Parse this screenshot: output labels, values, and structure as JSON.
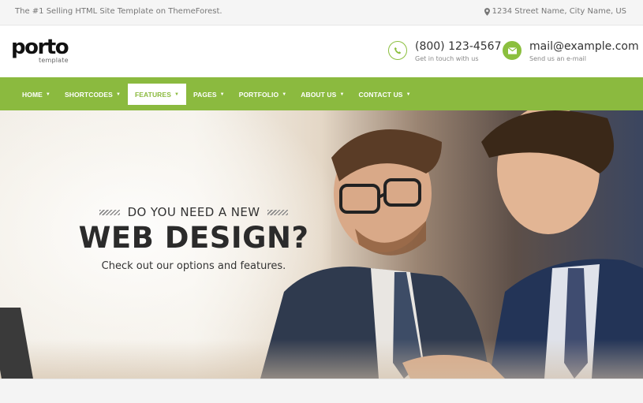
{
  "topbar": {
    "tagline": "The #1 Selling HTML Site Template on ThemeForest.",
    "address": "1234 Street Name, City Name, US",
    "address_icon": "map-marker-icon"
  },
  "header": {
    "logo_word": "porto",
    "logo_sub": "template",
    "phone": {
      "number": "(800) 123-4567",
      "caption": "Get in touch with us",
      "icon": "phone-icon"
    },
    "email": {
      "address": "mail@example.com",
      "caption": "Send us an e-mail",
      "icon": "envelope-icon"
    }
  },
  "nav": {
    "items": [
      {
        "label": "HOME"
      },
      {
        "label": "SHORTCODES"
      },
      {
        "label": "FEATURES",
        "active": true
      },
      {
        "label": "PAGES"
      },
      {
        "label": "PORTFOLIO"
      },
      {
        "label": "ABOUT US"
      },
      {
        "label": "CONTACT US"
      }
    ],
    "caret": "▼"
  },
  "hero": {
    "pre_title": "DO YOU NEED A NEW",
    "title": "WEB DESIGN?",
    "subtitle": "Check out our options and features."
  },
  "colors": {
    "accent": "#8bba3f",
    "text_dark": "#2b2b2b"
  }
}
